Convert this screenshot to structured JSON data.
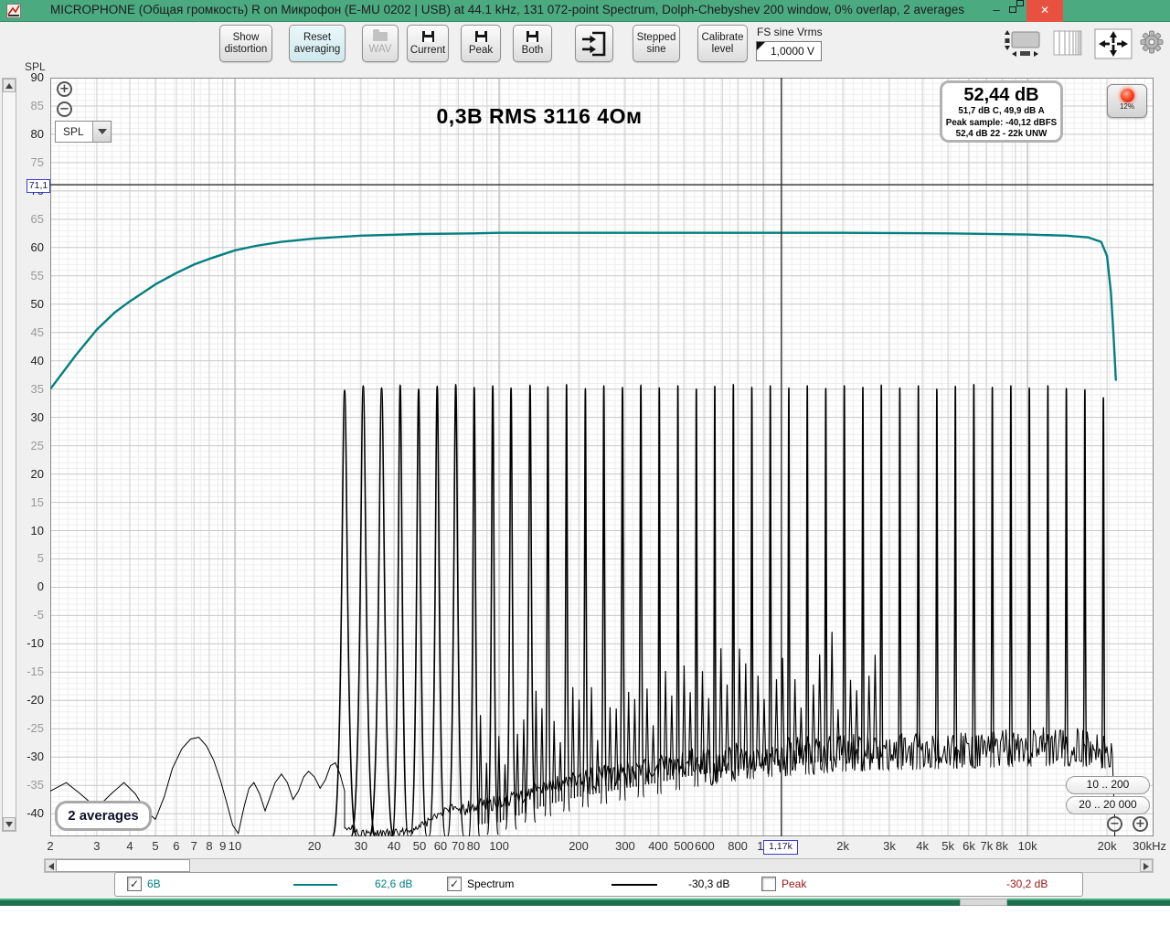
{
  "titlebar": {
    "title": "MICROPHONE (Общая громкость) R on Микрофон (E-MU 0202 | USB) at 44.1 kHz, 131 072-point Spectrum, Dolph-Chebyshev 200 window, 0% overlap, 2 averages",
    "minimize_glyph": "–",
    "close_glyph": "✕"
  },
  "toolbar": {
    "show_distortion": "Show distortion",
    "reset_averaging": "Reset averaging",
    "wav": "WAV",
    "current": "Current",
    "peak": "Peak",
    "both": "Both",
    "stepped_sine": "Stepped sine",
    "calibrate_level": "Calibrate level",
    "fs_sine_label": "FS sine Vrms",
    "fs_sine_value": "1,0000 V",
    "led_percent": "12%"
  },
  "plot": {
    "spl_corner_label": "SPL",
    "axis_mode": "SPL",
    "zoom_in_glyph": "+",
    "zoom_out_glyph": "−",
    "range_button_1": "10 .. 200",
    "range_button_2": "20 .. 20 000"
  },
  "readout_box": {
    "line1": "52,44 dB",
    "line2": "51,7 dB C, 49,9 dB A",
    "line3": "Peak sample: -40,12 dBFS",
    "line4": "52,4 dB 22 - 22k UNW"
  },
  "cursor": {
    "level_label": "71,1",
    "freq_label": "1,17k",
    "level_db": 71.1,
    "freq_hz": 1170
  },
  "legend": {
    "series": [
      {
        "label": "6В",
        "value": "62,6 dB",
        "color": "#008080",
        "checked": true
      },
      {
        "label": "Spectrum",
        "value": "-30,3 dB",
        "color": "#000000",
        "checked": true
      },
      {
        "label": "Peak",
        "value": "-30,2 dB",
        "color": "#9b1313",
        "checked": false
      }
    ]
  },
  "chart_data": {
    "type": "line",
    "title": "0,3В RMS 3116 4Ом",
    "averages_label": "2 averages",
    "x_axis": {
      "scale": "log",
      "unit": "Hz",
      "min_hz": 2,
      "max_hz": 30000,
      "ticks": [
        {
          "f": 2,
          "l": "2"
        },
        {
          "f": 3,
          "l": "3"
        },
        {
          "f": 4,
          "l": "4"
        },
        {
          "f": 5,
          "l": "5"
        },
        {
          "f": 6,
          "l": "6"
        },
        {
          "f": 7,
          "l": "7"
        },
        {
          "f": 8,
          "l": "8"
        },
        {
          "f": 9,
          "l": "9"
        },
        {
          "f": 10,
          "l": "10"
        },
        {
          "f": 20,
          "l": "20"
        },
        {
          "f": 30,
          "l": "30"
        },
        {
          "f": 40,
          "l": "40"
        },
        {
          "f": 50,
          "l": "50"
        },
        {
          "f": 60,
          "l": "60"
        },
        {
          "f": 70,
          "l": "70"
        },
        {
          "f": 80,
          "l": "80"
        },
        {
          "f": 100,
          "l": "100"
        },
        {
          "f": 200,
          "l": "200"
        },
        {
          "f": 300,
          "l": "300"
        },
        {
          "f": 400,
          "l": "400"
        },
        {
          "f": 500,
          "l": "500"
        },
        {
          "f": 600,
          "l": "600"
        },
        {
          "f": 800,
          "l": "800"
        },
        {
          "f": 1000,
          "l": "1k"
        },
        {
          "f": 2000,
          "l": "2k"
        },
        {
          "f": 3000,
          "l": "3k"
        },
        {
          "f": 4000,
          "l": "4k"
        },
        {
          "f": 5000,
          "l": "5k"
        },
        {
          "f": 6000,
          "l": "6k"
        },
        {
          "f": 7000,
          "l": "7k"
        },
        {
          "f": 8000,
          "l": "8k"
        },
        {
          "f": 10000,
          "l": "10k"
        },
        {
          "f": 20000,
          "l": "20k"
        },
        {
          "f": 30000,
          "l": "30kHz"
        }
      ]
    },
    "y_axis": {
      "label": "SPL",
      "unit": "dB",
      "plot_min": -44,
      "plot_max": 90,
      "label_max": 90,
      "label_min": -40,
      "step": 5
    },
    "series": [
      {
        "name": "6В",
        "type": "response_curve",
        "color": "#047f7f",
        "level": "62,6 dB",
        "points": [
          [
            2,
            35
          ],
          [
            2.5,
            41
          ],
          [
            3,
            45.5
          ],
          [
            3.5,
            48.5
          ],
          [
            4,
            50.5
          ],
          [
            5,
            53.5
          ],
          [
            6,
            55.5
          ],
          [
            7,
            57
          ],
          [
            8,
            58
          ],
          [
            10,
            59.5
          ],
          [
            12,
            60.3
          ],
          [
            15,
            61
          ],
          [
            20,
            61.6
          ],
          [
            30,
            62.1
          ],
          [
            50,
            62.4
          ],
          [
            80,
            62.5
          ],
          [
            100,
            62.6
          ],
          [
            200,
            62.6
          ],
          [
            500,
            62.6
          ],
          [
            1000,
            62.6
          ],
          [
            2000,
            62.6
          ],
          [
            5000,
            62.5
          ],
          [
            10000,
            62.3
          ],
          [
            14000,
            62.1
          ],
          [
            17000,
            61.8
          ],
          [
            19000,
            61
          ],
          [
            20000,
            58.5
          ],
          [
            20700,
            52
          ],
          [
            21200,
            44
          ],
          [
            21600,
            36.5
          ]
        ]
      },
      {
        "name": "Spectrum",
        "type": "spectrum",
        "color": "#000000",
        "level": "-30,3 dB",
        "low_freq_trace": [
          [
            2,
            -36
          ],
          [
            2.3,
            -34.5
          ],
          [
            2.6,
            -36.5
          ],
          [
            3,
            -39
          ],
          [
            3.4,
            -36.5
          ],
          [
            3.8,
            -34.5
          ],
          [
            4.2,
            -36.5
          ],
          [
            4.6,
            -39.5
          ],
          [
            5,
            -41
          ],
          [
            5.4,
            -37
          ],
          [
            5.8,
            -32
          ],
          [
            6.3,
            -28.5
          ],
          [
            6.8,
            -26.8
          ],
          [
            7.3,
            -26.5
          ],
          [
            7.8,
            -28
          ],
          [
            8.3,
            -30.5
          ],
          [
            8.8,
            -34
          ],
          [
            9.3,
            -38
          ],
          [
            9.8,
            -42
          ],
          [
            10.3,
            -43.5
          ],
          [
            10.8,
            -39
          ],
          [
            11.3,
            -35.5
          ],
          [
            11.8,
            -34.5
          ],
          [
            12.4,
            -36.5
          ],
          [
            13,
            -39.5
          ],
          [
            13.6,
            -37
          ],
          [
            14.2,
            -34.5
          ],
          [
            15,
            -33
          ],
          [
            15.8,
            -34.5
          ],
          [
            16.6,
            -37.5
          ],
          [
            17.4,
            -36
          ],
          [
            18.2,
            -33.5
          ],
          [
            19,
            -32.5
          ],
          [
            20,
            -33.5
          ],
          [
            21,
            -35.5
          ],
          [
            22,
            -34
          ],
          [
            23,
            -31.5
          ],
          [
            24,
            -31
          ],
          [
            25,
            -33
          ],
          [
            26,
            -36
          ]
        ],
        "noise_floor": [
          [
            26,
            -42
          ],
          [
            30,
            -43.5
          ],
          [
            40,
            -43.5
          ],
          [
            50,
            -42.5
          ],
          [
            60,
            -40
          ],
          [
            70,
            -38.5
          ],
          [
            80,
            -38
          ],
          [
            100,
            -37.5
          ],
          [
            150,
            -34.5
          ],
          [
            200,
            -33
          ],
          [
            300,
            -31.5
          ],
          [
            400,
            -30.5
          ],
          [
            500,
            -29.5
          ],
          [
            700,
            -28.5
          ],
          [
            1000,
            -27.5
          ],
          [
            1500,
            -27
          ],
          [
            2000,
            -26.5
          ],
          [
            3000,
            -26.2
          ],
          [
            5000,
            -26
          ],
          [
            8000,
            -25.7
          ],
          [
            12000,
            -25.5
          ],
          [
            16000,
            -25.6
          ],
          [
            20000,
            -26
          ],
          [
            20800,
            -28
          ],
          [
            21200,
            -34
          ],
          [
            21500,
            -44
          ]
        ],
        "tones": [
          [
            26,
            34.8
          ],
          [
            30.6,
            35.6
          ],
          [
            35.9,
            35.2
          ],
          [
            42.2,
            35.7
          ],
          [
            49.6,
            35.0
          ],
          [
            58.3,
            35.5
          ],
          [
            68.5,
            35.8
          ],
          [
            80.5,
            35.3
          ],
          [
            94.6,
            35.6
          ],
          [
            111,
            35.2
          ],
          [
            131,
            35.7
          ],
          [
            153,
            35.4
          ],
          [
            180,
            35.8
          ],
          [
            212,
            35.1
          ],
          [
            249,
            35.6
          ],
          [
            293,
            35.3
          ],
          [
            344,
            35.7
          ],
          [
            404,
            35.2
          ],
          [
            475,
            35.6
          ],
          [
            558,
            35.0
          ],
          [
            655,
            35.5
          ],
          [
            770,
            35.8
          ],
          [
            905,
            35.3
          ],
          [
            1063,
            35.6
          ],
          [
            1249,
            35.2
          ],
          [
            1467,
            35.6
          ],
          [
            1724,
            35.1
          ],
          [
            2026,
            35.6
          ],
          [
            2381,
            35.3
          ],
          [
            2797,
            35.7
          ],
          [
            3287,
            35.2
          ],
          [
            3862,
            35.6
          ],
          [
            4538,
            35.0
          ],
          [
            5332,
            35.5
          ],
          [
            6265,
            35.8
          ],
          [
            7361,
            35.3
          ],
          [
            8649,
            35.6
          ],
          [
            10163,
            35.2
          ],
          [
            11941,
            35.6
          ],
          [
            14031,
            35.1
          ],
          [
            16486,
            34.9
          ],
          [
            19371,
            33.5
          ]
        ]
      }
    ]
  }
}
